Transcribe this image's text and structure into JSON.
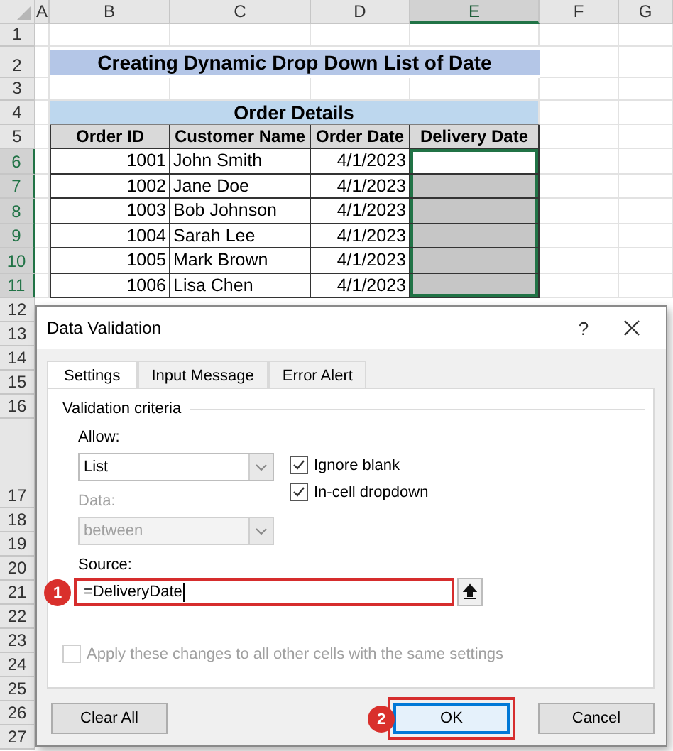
{
  "sheet": {
    "columns": [
      {
        "label": "A",
        "selected": false
      },
      {
        "label": "B",
        "selected": false
      },
      {
        "label": "C",
        "selected": false
      },
      {
        "label": "D",
        "selected": false
      },
      {
        "label": "E",
        "selected": true
      },
      {
        "label": "F",
        "selected": false
      },
      {
        "label": "G",
        "selected": false
      }
    ],
    "row_numbers": [
      {
        "label": "1",
        "selected": false
      },
      {
        "label": "2",
        "selected": false
      },
      {
        "label": "3",
        "selected": false
      },
      {
        "label": "4",
        "selected": false
      },
      {
        "label": "5",
        "selected": false
      },
      {
        "label": "6",
        "selected": true
      },
      {
        "label": "7",
        "selected": true
      },
      {
        "label": "8",
        "selected": true
      },
      {
        "label": "9",
        "selected": true
      },
      {
        "label": "10",
        "selected": true
      },
      {
        "label": "11",
        "selected": true
      },
      {
        "label": "12",
        "selected": false
      },
      {
        "label": "13",
        "selected": false
      },
      {
        "label": "14",
        "selected": false
      },
      {
        "label": "15",
        "selected": false
      },
      {
        "label": "16",
        "selected": false
      },
      {
        "label": "17",
        "selected": false
      },
      {
        "label": "18",
        "selected": false
      },
      {
        "label": "19",
        "selected": false
      },
      {
        "label": "20",
        "selected": false
      },
      {
        "label": "21",
        "selected": false
      },
      {
        "label": "22",
        "selected": false
      },
      {
        "label": "23",
        "selected": false
      },
      {
        "label": "24",
        "selected": false
      },
      {
        "label": "25",
        "selected": false
      },
      {
        "label": "26",
        "selected": false
      },
      {
        "label": "27",
        "selected": false
      }
    ],
    "title": "Creating Dynamic Drop Down List of Date",
    "table": {
      "caption": "Order Details",
      "columns": [
        "Order ID",
        "Customer Name",
        "Order Date",
        "Delivery Date"
      ],
      "rows": [
        {
          "order_id": "1001",
          "customer": "John Smith",
          "order_date": "4/1/2023",
          "delivery_shaded": false
        },
        {
          "order_id": "1002",
          "customer": "Jane Doe",
          "order_date": "4/1/2023",
          "delivery_shaded": true
        },
        {
          "order_id": "1003",
          "customer": "Bob Johnson",
          "order_date": "4/1/2023",
          "delivery_shaded": true
        },
        {
          "order_id": "1004",
          "customer": "Sarah Lee",
          "order_date": "4/1/2023",
          "delivery_shaded": true
        },
        {
          "order_id": "1005",
          "customer": "Mark Brown",
          "order_date": "4/1/2023",
          "delivery_shaded": true
        },
        {
          "order_id": "1006",
          "customer": "Lisa Chen",
          "order_date": "4/1/2023",
          "delivery_shaded": true
        }
      ]
    }
  },
  "dialog": {
    "title": "Data Validation",
    "help": "?",
    "tabs": [
      {
        "label": "Settings",
        "selected": true
      },
      {
        "label": "Input Message",
        "selected": false
      },
      {
        "label": "Error Alert",
        "selected": false
      }
    ],
    "group_label": "Validation criteria",
    "allow": {
      "label": "Allow:",
      "value": "List",
      "disabled": false
    },
    "data": {
      "label": "Data:",
      "value": "between",
      "disabled": true
    },
    "checkboxes": [
      {
        "label": "Ignore blank",
        "checked": true
      },
      {
        "label": "In-cell dropdown",
        "checked": true
      }
    ],
    "source": {
      "label": "Source:",
      "value": "=DeliveryDate",
      "highlighted": true,
      "step": "1"
    },
    "apply": {
      "label": "Apply these changes to all other cells with the same settings",
      "checked": false,
      "disabled": true
    },
    "buttons": [
      {
        "label": "Clear All",
        "highlighted": false
      },
      {
        "label": "OK",
        "highlighted": true,
        "step": "2"
      },
      {
        "label": "Cancel",
        "highlighted": false
      }
    ]
  }
}
